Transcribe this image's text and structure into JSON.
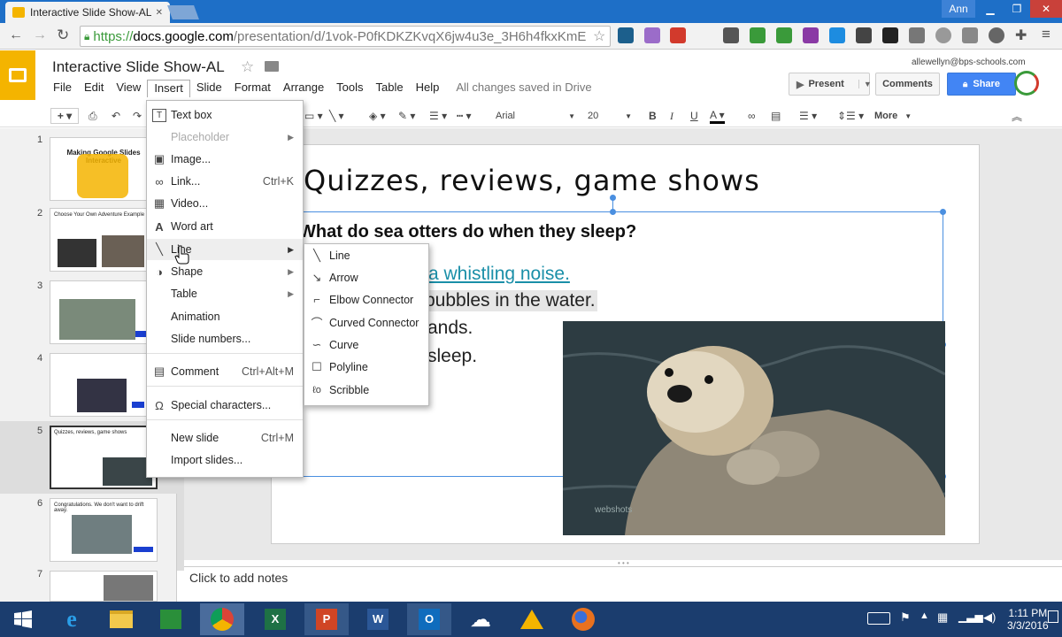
{
  "browser": {
    "tab_title": "Interactive Slide Show-AL",
    "tab_close": "✕",
    "user_badge": "Ann",
    "url": "https://docs.google.com/presentation/d/1vok-P0fKDKZKvqX6jw4u3e_3H6h4fkxKmE",
    "url_prefix": "https://",
    "url_domain": "docs.google.com",
    "url_path": "/presentation/d/1vok-P0fKDKZKvqX6jw4u3e_3H6h4fkxKmE"
  },
  "doc": {
    "title": "Interactive Slide Show-AL",
    "save_status": "All changes saved in Drive",
    "account": "allewellyn@bps-schools.com",
    "present_label": "Present",
    "comments_label": "Comments",
    "share_label": "Share"
  },
  "menubar": [
    "File",
    "Edit",
    "View",
    "Insert",
    "Slide",
    "Format",
    "Arrange",
    "Tools",
    "Table",
    "Help"
  ],
  "format_toolbar": {
    "font": "Arial",
    "size": "20",
    "more": "More"
  },
  "insert_menu": [
    {
      "label": "Text box",
      "icon": "text-box-icon",
      "glyph": "T",
      "key": "",
      "arrow": false,
      "disabled": false
    },
    {
      "label": "Placeholder",
      "icon": "",
      "glyph": "",
      "key": "",
      "arrow": true,
      "disabled": true
    },
    {
      "label": "Image...",
      "icon": "image-icon",
      "glyph": "▣",
      "key": "",
      "arrow": false,
      "disabled": false
    },
    {
      "label": "Link...",
      "icon": "link-icon",
      "glyph": "∞",
      "key": "Ctrl+K",
      "arrow": false,
      "disabled": false
    },
    {
      "label": "Video...",
      "icon": "video-icon",
      "glyph": "▦",
      "key": "",
      "arrow": false,
      "disabled": false
    },
    {
      "label": "Word art",
      "icon": "word-art-icon",
      "glyph": "A",
      "key": "",
      "arrow": false,
      "disabled": false
    },
    {
      "label": "Line",
      "icon": "line-icon",
      "glyph": "╲",
      "key": "",
      "arrow": true,
      "disabled": false
    },
    {
      "label": "Shape",
      "icon": "shape-icon",
      "glyph": "◑",
      "key": "",
      "arrow": true,
      "disabled": false
    },
    {
      "label": "Table",
      "icon": "",
      "glyph": "",
      "key": "",
      "arrow": true,
      "disabled": false
    },
    {
      "label": "Animation",
      "icon": "",
      "glyph": "",
      "key": "",
      "arrow": false,
      "disabled": false
    },
    {
      "label": "Slide numbers...",
      "icon": "",
      "glyph": "",
      "key": "",
      "arrow": false,
      "disabled": false
    },
    {
      "label": "Comment",
      "icon": "comment-icon",
      "glyph": "▤",
      "key": "Ctrl+Alt+M",
      "arrow": false,
      "disabled": false
    },
    {
      "label": "Special characters...",
      "icon": "omega-icon",
      "glyph": "Ω",
      "key": "",
      "arrow": false,
      "disabled": false
    },
    {
      "label": "New slide",
      "icon": "",
      "glyph": "",
      "key": "Ctrl+M",
      "arrow": false,
      "disabled": false
    },
    {
      "label": "Import slides...",
      "icon": "",
      "glyph": "",
      "key": "",
      "arrow": false,
      "disabled": false
    }
  ],
  "line_submenu": [
    {
      "label": "Line",
      "icon": "line-icon",
      "glyph": "╲"
    },
    {
      "label": "Arrow",
      "icon": "arrow-icon",
      "glyph": "↘"
    },
    {
      "label": "Elbow Connector",
      "icon": "elbow-connector-icon",
      "glyph": "⌐"
    },
    {
      "label": "Curved Connector",
      "icon": "curved-connector-icon",
      "glyph": "⌒"
    },
    {
      "label": "Curve",
      "icon": "curve-icon",
      "glyph": "∽"
    },
    {
      "label": "Polyline",
      "icon": "polyline-icon",
      "glyph": "☐"
    },
    {
      "label": "Scribble",
      "icon": "scribble-icon",
      "glyph": "ℓo"
    }
  ],
  "slide": {
    "title": "Quizzes, reviews, game shows",
    "question": "What do sea otters do when they sleep?",
    "answers": [
      "a whistling noise.",
      "bubbles in the water.",
      "ands.",
      "sleep."
    ],
    "image_watermark": "webshots"
  },
  "filmstrip": [
    {
      "num": "1",
      "text": "Making Google Slides Interactive"
    },
    {
      "num": "2",
      "text": "Choose Your Own Adventure Example"
    },
    {
      "num": "3",
      "text": ""
    },
    {
      "num": "4",
      "text": ""
    },
    {
      "num": "5",
      "text": "Quizzes, reviews, game shows"
    },
    {
      "num": "6",
      "text": "Congratulations.  We don't want to drift away."
    },
    {
      "num": "7",
      "text": ""
    }
  ],
  "notes_placeholder": "Click to add notes",
  "clock": {
    "time": "1:11 PM",
    "date": "3/3/2016"
  },
  "colors": {
    "accent": "#4285f4",
    "docs_yellow": "#f4b400",
    "link": "#1a8fa8",
    "taskbar": "#1b3d6e"
  }
}
